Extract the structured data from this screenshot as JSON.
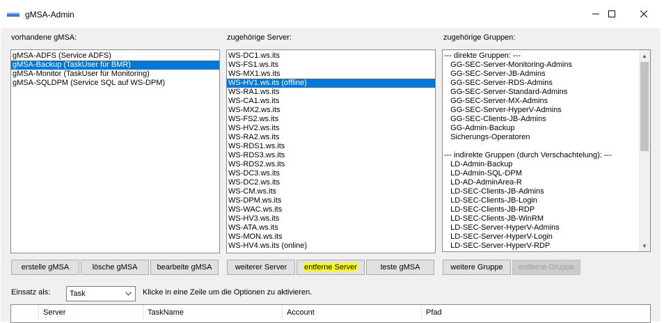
{
  "window": {
    "title": "gMSA-Admin"
  },
  "labels": {
    "gmsa": "vorhandene gMSA:",
    "server": "zugehörige Server:",
    "groups": "zugehörige Gruppen:",
    "einsatz": "Einsatz als:",
    "hint": "Klicke in eine Zeile um die Optionen zu aktivieren."
  },
  "gmsa_list": [
    {
      "text": "gMSA-ADFS (Service ADFS)",
      "selected": false
    },
    {
      "text": "gMSA-Backup (TaskUser für BMR)",
      "selected": true
    },
    {
      "text": "gMSA-Monitor (TaskUser für Monitoring)",
      "selected": false
    },
    {
      "text": "gMSA-SQLDPM (Service SQL auf WS-DPM)",
      "selected": false
    }
  ],
  "server_list": [
    {
      "text": "WS-DC1.ws.its",
      "selected": false
    },
    {
      "text": "WS-FS1.ws.its",
      "selected": false
    },
    {
      "text": "WS-MX1.ws.its",
      "selected": false
    },
    {
      "text": "WS-HV1.ws.its (offline)",
      "selected": true
    },
    {
      "text": "WS-RA1.ws.its",
      "selected": false
    },
    {
      "text": "WS-CA1.ws.its",
      "selected": false
    },
    {
      "text": "WS-MX2.ws.its",
      "selected": false
    },
    {
      "text": "WS-FS2.ws.its",
      "selected": false
    },
    {
      "text": "WS-HV2.ws.its",
      "selected": false
    },
    {
      "text": "WS-RA2.ws.its",
      "selected": false
    },
    {
      "text": "WS-RDS1.ws.its",
      "selected": false
    },
    {
      "text": "WS-RDS3.ws.its",
      "selected": false
    },
    {
      "text": "WS-RDS2.ws.its",
      "selected": false
    },
    {
      "text": "WS-DC3.ws.its",
      "selected": false
    },
    {
      "text": "WS-DC2.ws.its",
      "selected": false
    },
    {
      "text": "WS-CM.ws.its",
      "selected": false
    },
    {
      "text": "WS-DPM.ws.its",
      "selected": false
    },
    {
      "text": "WS-WAC.ws.its",
      "selected": false
    },
    {
      "text": "WS-HV3.ws.its",
      "selected": false
    },
    {
      "text": "WS-ATA.ws.its",
      "selected": false
    },
    {
      "text": "WS-MON.ws.its",
      "selected": false
    },
    {
      "text": "WS-HV4.ws.its (online)",
      "selected": false
    }
  ],
  "group_list": [
    "--- direkte Gruppen: ---",
    "   GG-SEC-Server-Monitoring-Admins",
    "   GG-SEC-Server-JB-Admins",
    "   GG-SEC-Server-RDS-Admins",
    "   GG-SEC-Server-Standard-Admins",
    "   GG-SEC-Server-MX-Admins",
    "   GG-SEC-Server-HyperV-Admins",
    "   GG-SEC-Clients-JB-Admins",
    "   GG-Admin-Backup",
    "   Sicherungs-Operatoren",
    "",
    "--- indirekte Gruppen (durch Verschachtelung): ---",
    "   LD-Admin-Backup",
    "   LD-Admin-SQL-DPM",
    "   LD-AD-AdminArea-R",
    "   LD-SEC-Clients-JB-Admins",
    "   LD-SEC-Clients-JB-Login",
    "   LD-SEC-Clients-JB-RDP",
    "   LD-SEC-Clients-JB-WinRM",
    "   LD-SEC-Server-HyperV-Admins",
    "   LD-SEC-Server-HyperV-Login",
    "   LD-SEC-Server-HyperV-RDP"
  ],
  "buttons": {
    "create": "erstelle gMSA",
    "delete": "lösche gMSA",
    "edit": "bearbeite gMSA",
    "add_server": "weiterer Server",
    "remove_server": "entferne Server",
    "test": "teste gMSA",
    "add_group": "weitere Gruppe",
    "remove_group": "entferne Gruppe"
  },
  "einsatz_select": {
    "value": "Task"
  },
  "table": {
    "columns": [
      "Server",
      "TaskName",
      "Account",
      "Pfad"
    ]
  },
  "colors": {
    "selection": "#0078d7",
    "highlight": "#ffff00"
  }
}
